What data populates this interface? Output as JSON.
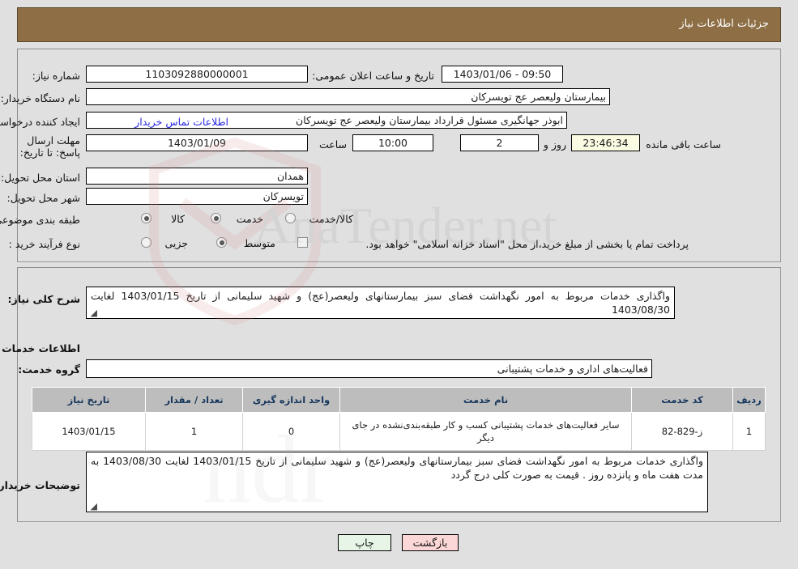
{
  "header": {
    "title": "جزئیات اطلاعات نیاز"
  },
  "form": {
    "need_number_label": "شماره نیاز:",
    "need_number_value": "1103092880000001",
    "announce_label": "تاریخ و ساعت اعلان عمومی:",
    "announce_value": "09:50 - 1403/01/06",
    "buyer_org_label": "نام دستگاه خریدار:",
    "buyer_org_value": "بیمارستان ولیعصر  عج  تویسرکان",
    "creator_label": "ایجاد کننده درخواست:",
    "creator_value": "ابوذر جهانگیری مسئول قرارداد بیمارستان ولیعصر  عج  تویسرکان",
    "contact_link": "اطلاعات تماس خریدار",
    "deadline_label": "مهلت ارسال پاسخ: تا تاریخ:",
    "deadline_date": "1403/01/09",
    "hour_label": "ساعت",
    "hour_value": "10:00",
    "days_value": "2",
    "days_label": "روز و",
    "countdown_value": "23:46:34",
    "countdown_label": "ساعت باقی مانده",
    "province_label": "استان محل تحویل:",
    "province_value": "همدان",
    "city_label": "شهر محل تحویل:",
    "city_value": "تویسرکان",
    "category_label": "طبقه بندی موضوعی:",
    "category_options": [
      {
        "label": "کالا",
        "selected": false
      },
      {
        "label": "خدمت",
        "selected": true
      },
      {
        "label": "کالا/خدمت",
        "selected": false
      }
    ],
    "process_label": "نوع فرآیند خرید :",
    "process_options": [
      {
        "label": "جزیی",
        "selected": false
      },
      {
        "label": "متوسط",
        "selected": true
      }
    ],
    "treasury_checkbox_label": "پرداخت تمام یا بخشی از مبلغ خرید،از محل \"اسناد خزانه اسلامی\" خواهد بود.",
    "treasury_checked": false
  },
  "details": {
    "summary_label": "شرح کلی نیاز:",
    "summary_value": "واگذاری خدمات مربوط به امور نگهداشت فضای سبز بیمارستانهای ولیعصر(عج) و شهید سلیمانی از تاریخ 1403/01/15 لغایت 1403/08/30",
    "services_heading": "اطلاعات خدمات مورد نیاز",
    "service_group_label": "گروه خدمت:",
    "service_group_value": "فعالیت‌های اداری و خدمات پشتیبانی",
    "notes_label": "توضیحات خریدار:",
    "notes_value": "واگذاری خدمات مربوط به امور نگهداشت فضای سبز بیمارستانهای ولیعصر(عج) و شهید سلیمانی از تاریخ 1403/01/15 لغایت 1403/08/30 به مدت هفت ماه و پانزده روز . قیمت به صورت کلی درج گردد"
  },
  "table": {
    "columns": [
      "ردیف",
      "کد خدمت",
      "نام خدمت",
      "واحد اندازه گیری",
      "تعداد / مقدار",
      "تاریخ نیاز"
    ],
    "rows": [
      {
        "row": "1",
        "code": "ز-829-82",
        "name": "سایر فعالیت‌های خدمات پشتیبانی کسب و کار طبقه‌بندی‌نشده در جای دیگر",
        "unit": "0",
        "qty": "1",
        "date": "1403/01/15"
      }
    ]
  },
  "footer": {
    "print_label": "چاپ",
    "back_label": "بازگشت"
  },
  "watermark": {
    "text": "AnaTender.net"
  }
}
